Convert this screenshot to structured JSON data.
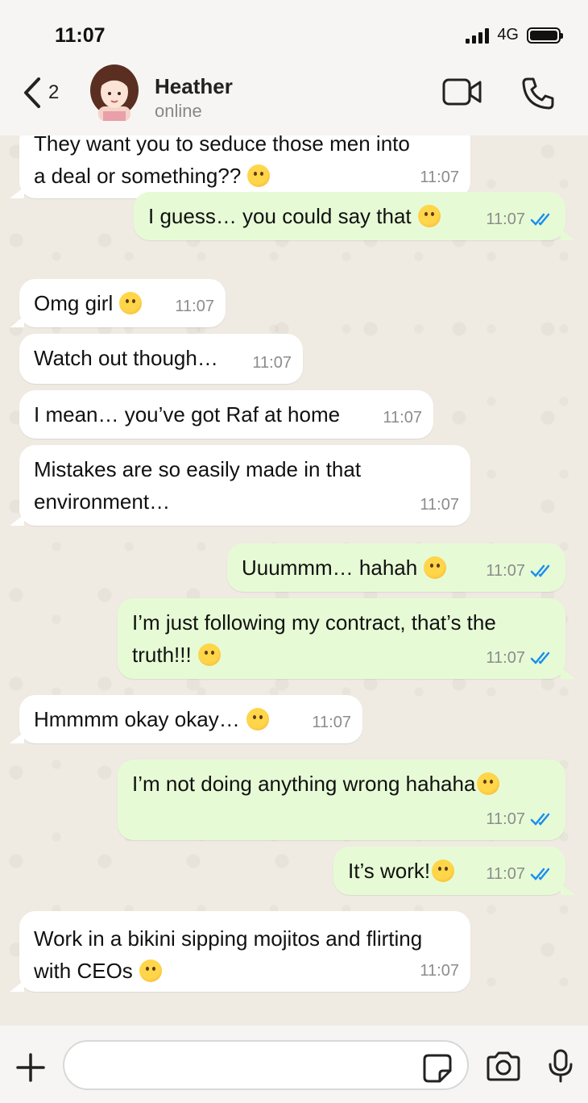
{
  "status_bar": {
    "time": "11:07",
    "network": "4G"
  },
  "header": {
    "back_count": "2",
    "contact_name": "Heather",
    "contact_status": "online"
  },
  "messages": [
    {
      "dir": "in",
      "text1": "They want you to seduce those men into",
      "text2": "a deal or something??",
      "emoji": "flushed-face",
      "time": "11:07"
    },
    {
      "dir": "out",
      "text1": "I guess… you could say that",
      "emoji": "upside-down-face",
      "time": "11:07",
      "read": true
    },
    {
      "dir": "in",
      "text1": "Omg girl",
      "emoji": "laughing-face",
      "time": "11:07"
    },
    {
      "dir": "in",
      "text1": "Watch out though…",
      "time": "11:07"
    },
    {
      "dir": "in",
      "text1": "I mean… you’ve got Raf at home",
      "time": "11:07"
    },
    {
      "dir": "in",
      "text1": "Mistakes are so easily made in that",
      "text2": "environment…",
      "time": "11:07"
    },
    {
      "dir": "out",
      "text1": "Uuummm… hahah",
      "emoji": "grinning-sweat-face",
      "time": "11:07",
      "read": true
    },
    {
      "dir": "out",
      "text1": "I’m just following my contract, that’s the",
      "text2": "truth!!!",
      "emoji": "grimacing-face",
      "time": "11:07",
      "read": true
    },
    {
      "dir": "in",
      "text1": "Hmmmm okay okay…",
      "emoji": "face-with-rolling-eyes",
      "time": "11:07"
    },
    {
      "dir": "out",
      "text1": "I’m not doing anything wrong hahaha",
      "emoji": "holding-back-tears-face",
      "time": "11:07",
      "read": true
    },
    {
      "dir": "out",
      "text1": "It’s work!",
      "emoji": "upside-down-face",
      "time": "11:07",
      "read": true
    },
    {
      "dir": "in",
      "text1": "Work in a bikini sipping mojitos and flirting",
      "text2": "with CEOs",
      "emoji": "rolling-on-floor-laughing",
      "time": "11:07"
    }
  ],
  "input": {
    "placeholder": ""
  },
  "icons": {
    "back": "chevron-left-icon",
    "video": "video-call-icon",
    "phone": "phone-icon",
    "plus": "plus-icon",
    "sticker": "sticker-icon",
    "camera": "camera-icon",
    "mic": "microphone-icon",
    "read_receipt": "double-check-icon"
  },
  "colors": {
    "incoming_bubble": "#ffffff",
    "outgoing_bubble": "#e6fbd5",
    "read_tick": "#1d8ef0",
    "background": "#efeae2"
  }
}
